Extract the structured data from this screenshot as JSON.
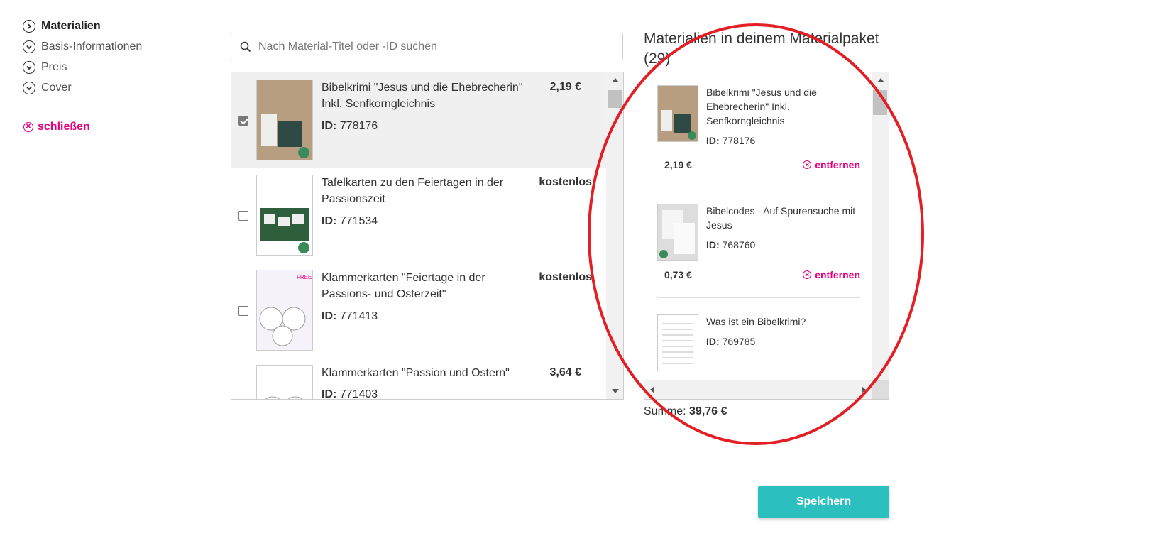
{
  "nav": {
    "items": [
      {
        "label": "Materialien",
        "active": true,
        "icon": "chevron-right-icon"
      },
      {
        "label": "Basis-Informationen",
        "active": false,
        "icon": "chevron-down-icon"
      },
      {
        "label": "Preis",
        "active": false,
        "icon": "chevron-down-icon"
      },
      {
        "label": "Cover",
        "active": false,
        "icon": "chevron-down-icon"
      }
    ],
    "close_label": "schließen"
  },
  "search": {
    "placeholder": "Nach Material-Titel oder -ID suchen",
    "value": ""
  },
  "materials": {
    "id_label": "ID:",
    "items": [
      {
        "title": "Bibelkrimi \"Jesus und die Ehebrecherin\" Inkl. Senfkorngleichnis",
        "id": "778176",
        "price": "2,19 €",
        "checked": true
      },
      {
        "title": "Tafelkarten zu den Feiertagen in der Passionszeit",
        "id": "771534",
        "price": "kostenlos",
        "checked": false
      },
      {
        "title": "Klammerkarten \"Feiertage in der Passions- und Osterzeit\"",
        "id": "771413",
        "price": "kostenlos",
        "checked": false
      },
      {
        "title": "Klammerkarten \"Passion und Ostern\"",
        "id": "771403",
        "price": "3,64 €",
        "checked": false
      }
    ]
  },
  "package": {
    "title": "Materialien in deinem Materialpaket (29)",
    "id_label": "ID:",
    "remove_label": "entfernen",
    "items": [
      {
        "title": "Bibelkrimi \"Jesus und die Ehebrecherin\" Inkl. Senfkorngleichnis",
        "id": "778176",
        "price": "2,19 €"
      },
      {
        "title": "Bibelcodes - Auf Spurensuche mit Jesus",
        "id": "768760",
        "price": "0,73 €"
      },
      {
        "title": "Was ist ein Bibelkrimi?",
        "id": "769785",
        "price": ""
      }
    ],
    "sum_label": "Summe:",
    "sum_value": "39,76 €"
  },
  "save_label": "Speichern",
  "colors": {
    "accent": "#e6007e",
    "button": "#2bbfbf",
    "annotation": "#e31e24"
  }
}
